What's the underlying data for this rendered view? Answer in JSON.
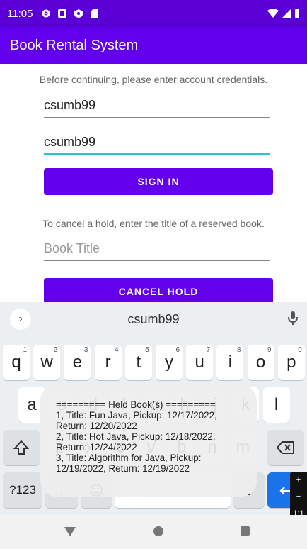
{
  "status_bar": {
    "time": "11:05"
  },
  "app_bar": {
    "title": "Book Rental System"
  },
  "login": {
    "instruction": "Before continuing, please enter account credentials.",
    "username_value": "csumb99",
    "password_value": "csumb99",
    "sign_in_label": "SIGN IN"
  },
  "hold": {
    "instruction": "To cancel a hold, enter the title of a reserved book.",
    "title_placeholder": "Book Title",
    "cancel_label": "CANCEL HOLD"
  },
  "keyboard": {
    "suggestion": "csumb99",
    "row1": [
      {
        "k": "q",
        "n": "1"
      },
      {
        "k": "w",
        "n": "2"
      },
      {
        "k": "e",
        "n": "3"
      },
      {
        "k": "r",
        "n": "4"
      },
      {
        "k": "t",
        "n": "5"
      },
      {
        "k": "y",
        "n": "6"
      },
      {
        "k": "u",
        "n": "7"
      },
      {
        "k": "i",
        "n": "8"
      },
      {
        "k": "o",
        "n": "9"
      },
      {
        "k": "p",
        "n": "0"
      }
    ],
    "row2": [
      "a",
      "s",
      "d",
      "f",
      "g",
      "h",
      "j",
      "k",
      "l"
    ],
    "row3": [
      "z",
      "x",
      "c",
      "v",
      "b",
      "n",
      "m"
    ],
    "symbols_label": "?123",
    "comma_label": ",",
    "period_label": "."
  },
  "toast": {
    "lines": [
      "========= Held Book(s) =========",
      "1, Title: Fun Java, Pickup: 12/17/2022,",
      "Return: 12/20/2022",
      "2, Title: Hot Java, Pickup: 12/18/2022,",
      "Return: 12/24/2022",
      "3, Title: Algorithm for Java, Pickup:",
      "12/19/2022, Return: 12/19/2022"
    ]
  },
  "side_pill": {
    "plus": "+",
    "minus": "−",
    "ratio": "1:1"
  }
}
